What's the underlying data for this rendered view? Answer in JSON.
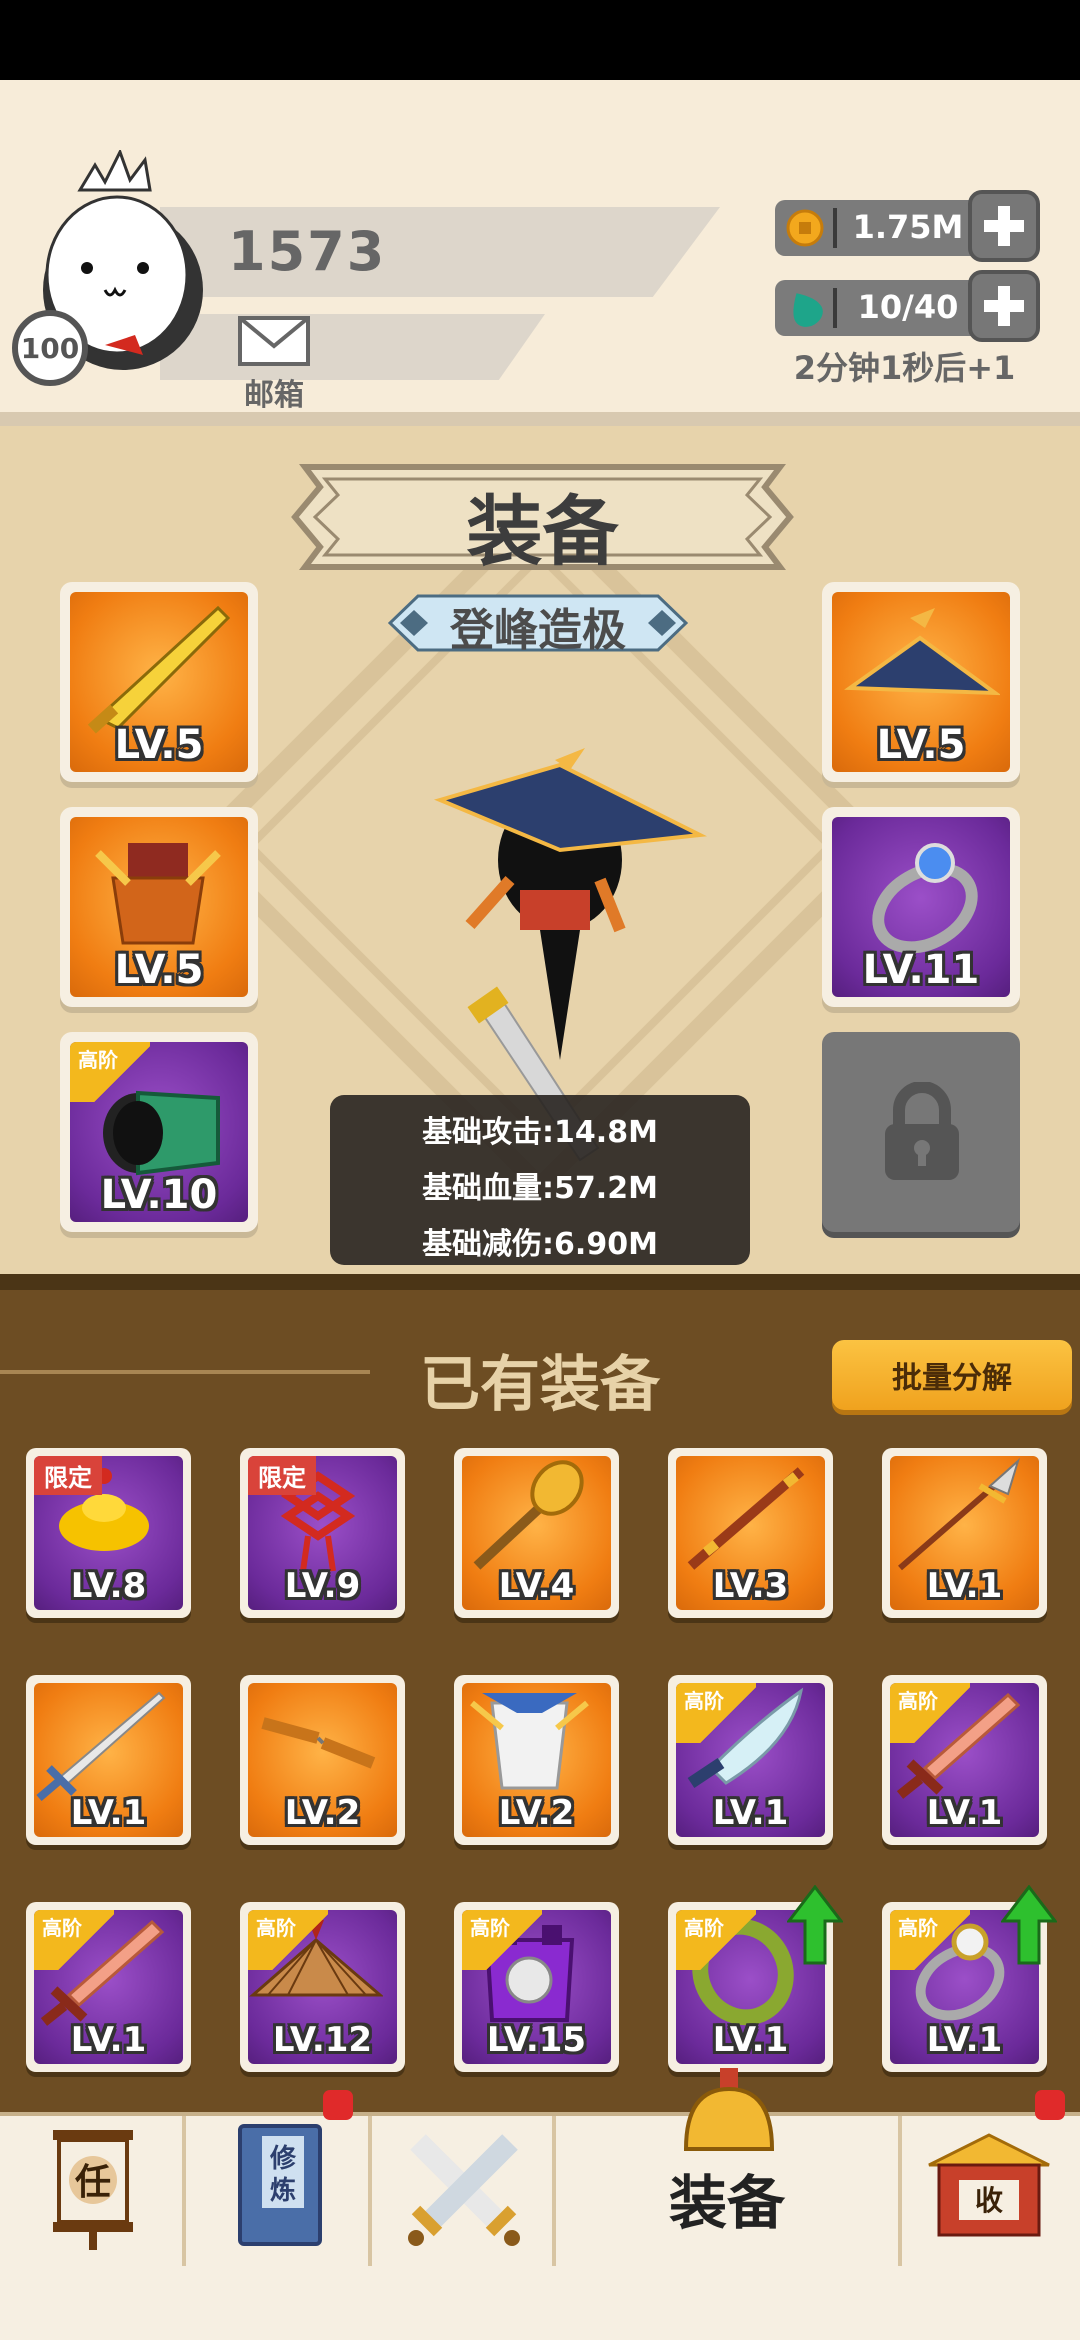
{
  "header": {
    "player_level": "100",
    "score": "1573",
    "mail_label": "邮箱",
    "resources": {
      "coins": "1.75M",
      "energy": "10/40",
      "energy_timer": "2分钟1秒后+1"
    }
  },
  "equipment": {
    "title": "装备",
    "rank_label": "登峰造极",
    "slots": [
      {
        "lv": "LV.5",
        "icon": "golden-saber-icon",
        "tier": "orange"
      },
      {
        "lv": "LV.5",
        "icon": "armor-icon",
        "tier": "orange"
      },
      {
        "lv": "LV.10",
        "icon": "bracer-icon",
        "tier": "purple",
        "tag": "高阶"
      },
      {
        "lv": "LV.5",
        "icon": "straw-hat-icon",
        "tier": "orange"
      },
      {
        "lv": "LV.11",
        "icon": "ring-icon",
        "tier": "purple"
      }
    ],
    "locked_slot": "lock-icon",
    "stats": {
      "attack": "基础攻击:14.8M",
      "hp": "基础血量:57.2M",
      "damage_reduction": "基础减伤:6.90M"
    }
  },
  "owned": {
    "title": "已有装备",
    "batch_button": "批量分解",
    "items": [
      {
        "lv": "LV.8",
        "icon": "gold-ingot-icon",
        "tier": "purple",
        "tag": "限定"
      },
      {
        "lv": "LV.9",
        "icon": "chinese-knot-icon",
        "tier": "purple",
        "tag": "限定"
      },
      {
        "lv": "LV.4",
        "icon": "mace-icon",
        "tier": "orange"
      },
      {
        "lv": "LV.3",
        "icon": "staff-icon",
        "tier": "orange"
      },
      {
        "lv": "LV.1",
        "icon": "spear-icon",
        "tier": "orange"
      },
      {
        "lv": "LV.1",
        "icon": "sword-icon",
        "tier": "orange"
      },
      {
        "lv": "LV.2",
        "icon": "nunchaku-icon",
        "tier": "orange"
      },
      {
        "lv": "LV.2",
        "icon": "robe-icon",
        "tier": "orange"
      },
      {
        "lv": "LV.1",
        "icon": "broadsword-icon",
        "tier": "purple",
        "tag": "高阶"
      },
      {
        "lv": "LV.1",
        "icon": "wooden-sword-icon",
        "tier": "purple",
        "tag": "高阶"
      },
      {
        "lv": "LV.1",
        "icon": "wooden-sword-icon",
        "tier": "purple",
        "tag": "高阶"
      },
      {
        "lv": "LV.12",
        "icon": "bamboo-hat-icon",
        "tier": "purple",
        "tag": "高阶"
      },
      {
        "lv": "LV.15",
        "icon": "chest-armor-icon",
        "tier": "purple",
        "tag": "高阶"
      },
      {
        "lv": "LV.1",
        "icon": "jade-bracelet-icon",
        "tier": "purple",
        "tag": "高阶",
        "upgrade": true
      },
      {
        "lv": "LV.1",
        "icon": "pearl-ring-icon",
        "tier": "purple",
        "tag": "高阶",
        "upgrade": true
      }
    ]
  },
  "nav": {
    "tasks_char": "任",
    "training_text": "修炼",
    "equip_label": "装备",
    "shop_char": "收"
  },
  "colors": {
    "panel_cream": "#f7ecd9",
    "equip_bg": "#e7d3ab",
    "owned_bg": "#6d4d23",
    "orange_tier": "#f07d12",
    "purple_tier": "#6b2a9a",
    "batch_button": "#f0a21e",
    "badge_red": "#e02a2a"
  }
}
